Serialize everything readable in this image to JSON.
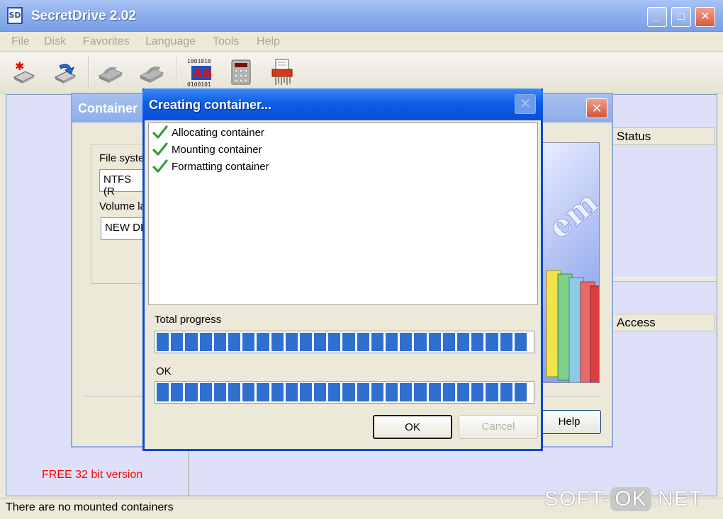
{
  "app": {
    "title": "SecretDrive 2.02",
    "icon_text": "SD"
  },
  "window_controls": {
    "minimize": "_",
    "maximize": "□",
    "close": "✕"
  },
  "menu": [
    "File",
    "Disk",
    "Favorites",
    "Language",
    "Tools",
    "Help"
  ],
  "toolbar": {
    "icons": [
      "new-container-icon",
      "mount-icon",
      "disk-icon-disabled",
      "disk-icon-disabled-2",
      "binary-abc-icon",
      "calculator-icon",
      "shredder-icon"
    ],
    "binary_text": "1001010\n01\n0100101"
  },
  "left_pane": {
    "free_label": "FREE 32 bit version"
  },
  "right_pane": {
    "headers": {
      "status": "Status",
      "access": "Access"
    }
  },
  "wizard": {
    "title": "Container",
    "close": "✕",
    "file_system_label": "File syste",
    "file_system_value": "NTFS (R",
    "volume_label_label": "Volume la",
    "volume_label_value": "NEW DI",
    "help_button": "Help",
    "art_text": "em"
  },
  "dialog": {
    "title": "Creating container...",
    "close": "✕",
    "log": [
      "Allocating container",
      "Mounting container",
      "Formatting container"
    ],
    "total_progress_label": "Total progress",
    "total_progress_fraction": 1.0,
    "step_label": "OK",
    "step_progress_fraction": 1.0,
    "ok_button": "OK",
    "cancel_button": "Cancel"
  },
  "status_bar": {
    "text": "There are no mounted containers"
  },
  "watermark": {
    "left": "SOFT-",
    "middle": "OK",
    "right": ".NET"
  },
  "colors": {
    "progress_fill": "#2f6fd0",
    "title_blue": "#0a4fd6",
    "free_label": "#ff0000",
    "check_green": "#3a9a3a"
  }
}
